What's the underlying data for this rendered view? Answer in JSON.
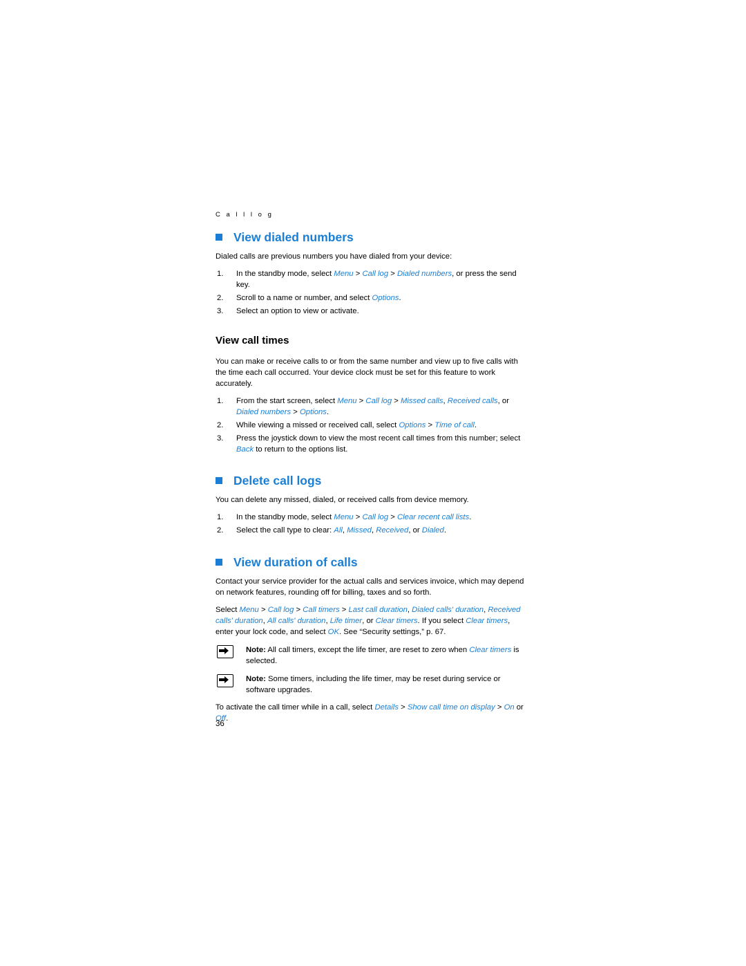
{
  "page": {
    "running_head": "C a l l   l o g",
    "page_number": "36",
    "accent_color": "#1a7fd4"
  },
  "sections": [
    {
      "id": "view-dialed-numbers",
      "heading": "View dialed numbers",
      "intro": "Dialed calls are previous numbers you have dialed from your device:",
      "steps": [
        {
          "num": "1.",
          "text": "In the standby mode, select Menu > Call log > Dialed numbers, or press the send key."
        },
        {
          "num": "2.",
          "text": "Scroll to a name or number, and select Options."
        },
        {
          "num": "3.",
          "text": "Select an option to view or activate."
        }
      ]
    },
    {
      "id": "view-call-times",
      "heading": "View call times",
      "intro": "You can make or receive calls to or from the same number and view up to five calls with the time each call occurred. Your device clock must be set for this feature to work accurately.",
      "steps": [
        {
          "num": "1.",
          "text": "From the start screen, select Menu > Call log > Missed calls, Received calls, or Dialed numbers > Options."
        },
        {
          "num": "2.",
          "text": "While viewing a missed or received call, select Options > Time of call."
        },
        {
          "num": "3.",
          "text": "Press the joystick down to view the most recent call times from this number; select Back to return to the options list."
        }
      ]
    },
    {
      "id": "delete-call-logs",
      "heading": "Delete call logs",
      "intro": "You can delete any missed, dialed, or received calls from device memory.",
      "steps": [
        {
          "num": "1.",
          "text": "In the standby mode, select Menu > Call log > Clear recent call lists."
        },
        {
          "num": "2.",
          "text": "Select the call type to clear: All, Missed, Received, or Dialed."
        }
      ]
    },
    {
      "id": "view-duration-of-calls",
      "heading": "View duration of calls",
      "intro": "Contact your service provider for the actual calls and services invoice, which may depend on network features, rounding off for billing, taxes and so forth.",
      "select_paragraph": "Select Menu > Call log > Call timers > Last call duration, Dialed calls' duration, Received calls' duration, All calls' duration, Life timer, or Clear timers. If you select Clear timers, enter your lock code, and select OK. See “Security settings,” p. 67.",
      "notes": [
        {
          "label": "Note:",
          "text": "All call timers, except the life timer, are reset to zero when Clear timers is selected."
        },
        {
          "label": "Note:",
          "text": "Some timers, including the life timer, may be reset during service or software upgrades."
        }
      ],
      "closing": "To activate the call timer while in a call, select Details > Show call time on display > On or Off."
    }
  ]
}
